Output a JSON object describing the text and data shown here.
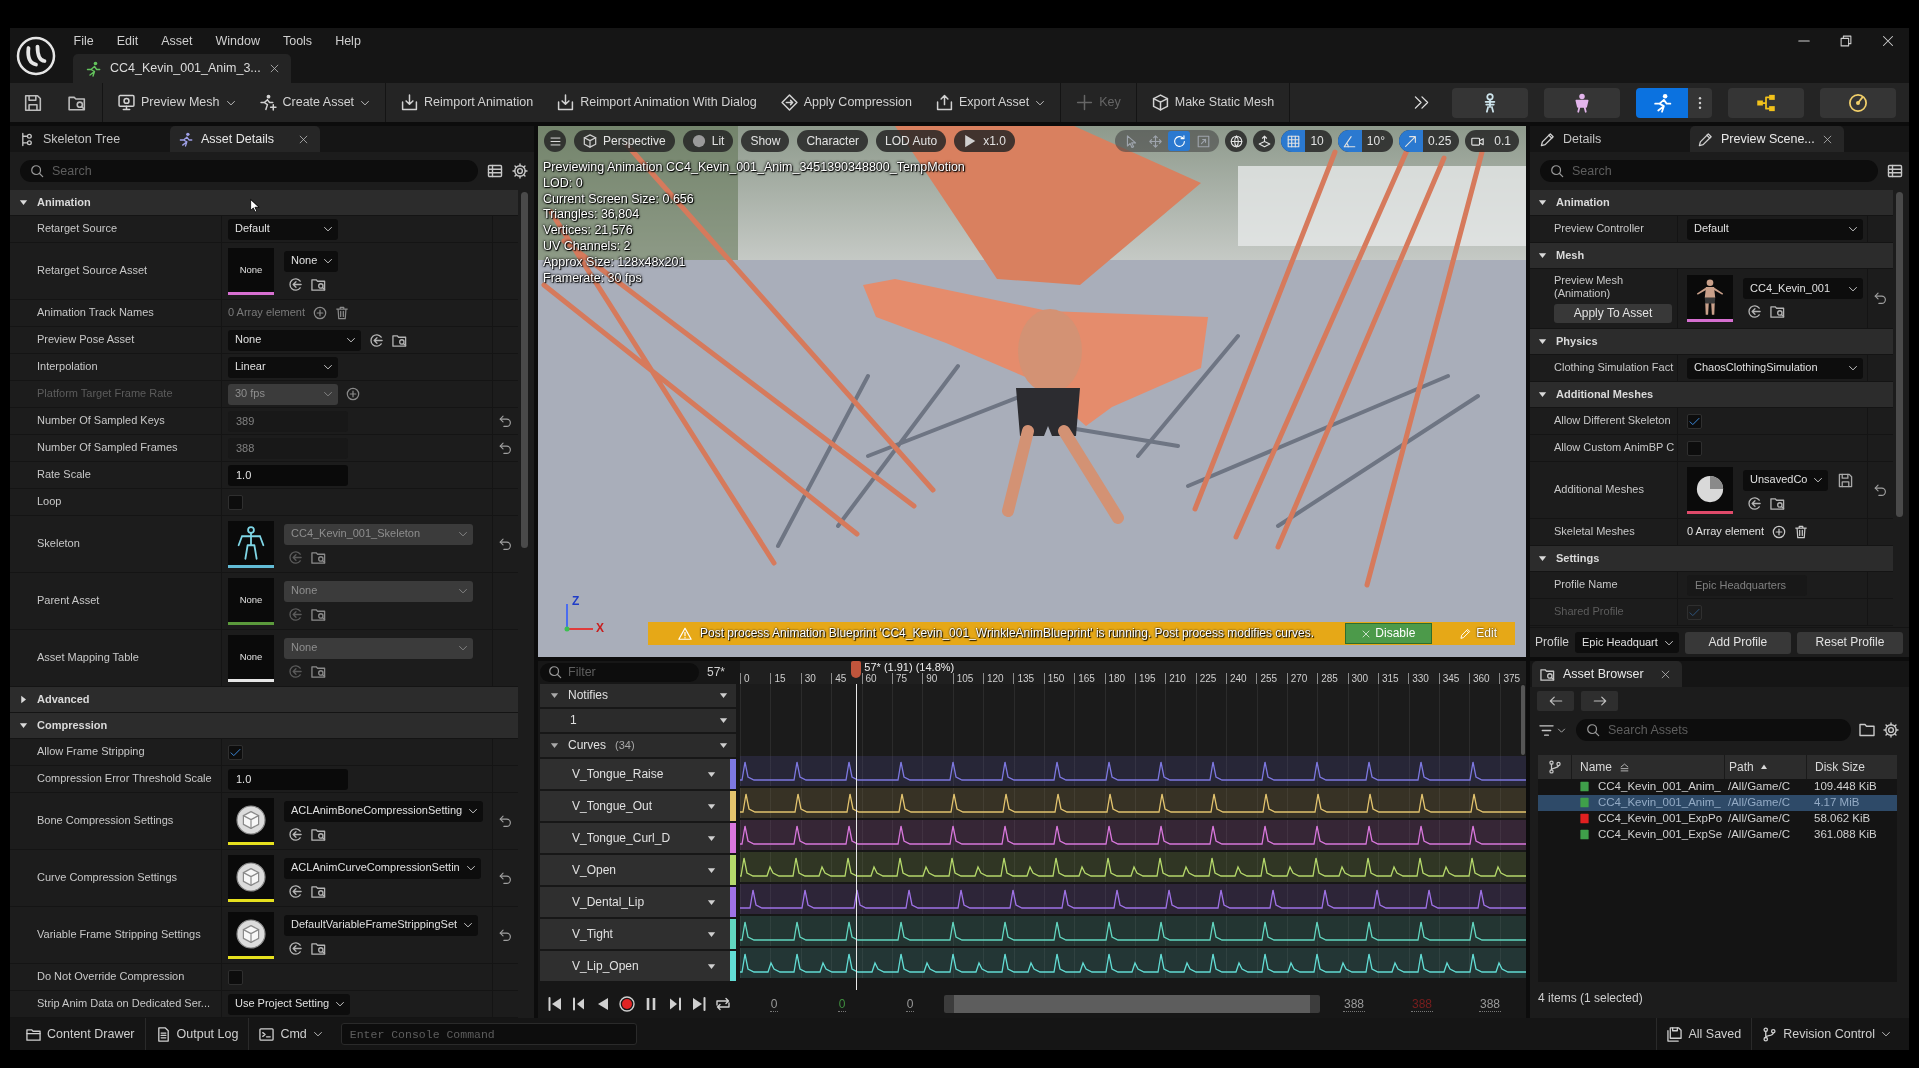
{
  "window": {
    "menu": [
      "File",
      "Edit",
      "Asset",
      "Window",
      "Tools",
      "Help"
    ],
    "document_tab": {
      "title": "CC4_Kevin_001_Anim_3...",
      "selected": true
    }
  },
  "toolbar": {
    "groups": [
      [
        {
          "label": "Preview Mesh",
          "dropdown": true,
          "disabled": false
        },
        {
          "label": "Create Asset",
          "dropdown": true,
          "disabled": false
        }
      ],
      [
        {
          "label": "Reimport Animation",
          "dropdown": false,
          "disabled": false
        },
        {
          "label": "Reimport Animation With Dialog",
          "dropdown": false,
          "disabled": false
        },
        {
          "label": "Apply Compression",
          "dropdown": false,
          "disabled": false
        },
        {
          "label": "Export Asset",
          "dropdown": true,
          "disabled": false
        }
      ],
      [
        {
          "label": "Key",
          "dropdown": false,
          "disabled": true
        }
      ],
      [
        {
          "label": "Make Static Mesh",
          "dropdown": false,
          "disabled": false
        }
      ]
    ],
    "modes": [
      {
        "selected": false
      },
      {
        "selected": false
      },
      {
        "selected": true
      },
      {
        "selected": false
      },
      {
        "selected": false
      }
    ]
  },
  "left_panel": {
    "tabs": [
      {
        "label": "Skeleton Tree",
        "selected": false
      },
      {
        "label": "Asset Details",
        "selected": true
      }
    ],
    "search": {
      "placeholder": "Search"
    },
    "sections": [
      {
        "title": "Animation",
        "expanded": true,
        "properties": [
          {
            "label": "Retarget Source",
            "kind": "dropdown",
            "value": "Default",
            "disabled": false,
            "read_only": false,
            "resettable": false
          },
          {
            "label": "Retarget Source Asset",
            "kind": "asset",
            "value": "None",
            "thumbnail": {
              "kind": "empty",
              "text": "None",
              "color": "#d66fd0"
            },
            "disabled": false,
            "read_only": false,
            "resettable": false
          },
          {
            "label": "Animation Track Names",
            "kind": "array",
            "value": "0 Array element",
            "disabled": false,
            "read_only": true,
            "resettable": false
          },
          {
            "label": "Preview Pose Asset",
            "kind": "asset_inline",
            "value": "None",
            "disabled": false,
            "read_only": false,
            "resettable": false
          },
          {
            "label": "Interpolation",
            "kind": "dropdown",
            "value": "Linear",
            "disabled": false,
            "read_only": false,
            "resettable": false
          },
          {
            "label": "Platform Target Frame Rate",
            "kind": "dropdown_add",
            "value": "30 fps",
            "disabled": true,
            "read_only": true,
            "resettable": false
          },
          {
            "label": "Number Of Sampled Keys",
            "kind": "number",
            "value": "389",
            "disabled": false,
            "read_only": true,
            "resettable": true
          },
          {
            "label": "Number Of Sampled Frames",
            "kind": "number",
            "value": "388",
            "disabled": false,
            "read_only": true,
            "resettable": true
          },
          {
            "label": "Rate Scale",
            "kind": "number",
            "value": "1.0",
            "disabled": false,
            "read_only": false,
            "resettable": false
          },
          {
            "label": "Loop",
            "kind": "checkbox",
            "checked": false,
            "disabled": false,
            "resettable": false
          },
          {
            "label": "Skeleton",
            "kind": "asset",
            "value": "CC4_Kevin_001_Skeleton",
            "thumbnail": {
              "kind": "skeleton",
              "color": "#62bcd6"
            },
            "disabled": false,
            "read_only": true,
            "resettable": true
          },
          {
            "label": "Parent Asset",
            "kind": "asset",
            "value": "None",
            "thumbnail": {
              "kind": "empty",
              "text": "None",
              "color": "#5b9a3c"
            },
            "disabled": false,
            "read_only": true,
            "resettable": false
          },
          {
            "label": "Asset Mapping Table",
            "kind": "asset",
            "value": "None",
            "thumbnail": {
              "kind": "empty",
              "text": "None",
              "color": "#e6e6e6"
            },
            "disabled": false,
            "read_only": true,
            "resettable": false
          }
        ]
      },
      {
        "title": "Advanced",
        "expanded": false
      },
      {
        "title": "Compression",
        "expanded": true,
        "properties": [
          {
            "label": "Allow Frame Stripping",
            "kind": "checkbox",
            "checked": true,
            "disabled": false,
            "resettable": false
          },
          {
            "label": "Compression Error Threshold Scale",
            "kind": "number",
            "value": "1.0",
            "disabled": false,
            "read_only": false,
            "resettable": false
          },
          {
            "label": "Bone Compression Settings",
            "kind": "asset",
            "value": "ACLAnimBoneCompressionSetting",
            "thumbnail": {
              "kind": "sphere",
              "color": "#e6e01e"
            },
            "disabled": false,
            "read_only": false,
            "resettable": true
          },
          {
            "label": "Curve Compression Settings",
            "kind": "asset",
            "value": "ACLAnimCurveCompressionSettin",
            "thumbnail": {
              "kind": "sphere",
              "color": "#e6e01e"
            },
            "disabled": false,
            "read_only": false,
            "resettable": true
          },
          {
            "label": "Variable Frame Stripping Settings",
            "kind": "asset",
            "value": "DefaultVariableFrameStrippingSet",
            "thumbnail": {
              "kind": "sphere",
              "color": "#e6e01e"
            },
            "disabled": false,
            "read_only": false,
            "resettable": true
          },
          {
            "label": "Do Not Override Compression",
            "kind": "checkbox",
            "checked": false,
            "disabled": false,
            "resettable": false
          },
          {
            "label": "Strip Anim Data on Dedicated Ser...",
            "kind": "dropdown",
            "value": "Use Project Setting",
            "disabled": false,
            "read_only": false,
            "resettable": false
          }
        ]
      }
    ]
  },
  "viewport": {
    "view_options": [
      "Perspective",
      "Lit",
      "Show",
      "Character",
      "LOD Auto",
      "x1.0"
    ],
    "transform_tools": [
      {
        "selected": false
      },
      {
        "selected": false
      },
      {
        "selected": true
      },
      {
        "selected": false
      }
    ],
    "snaps": [
      {
        "value": "10",
        "on": true
      },
      {
        "value": "10°",
        "on": true
      },
      {
        "value": "0.25",
        "on": true
      },
      {
        "value": "0.1",
        "on": false
      }
    ],
    "stats": [
      "Previewing Animation CC4_Kevin_001_Anim_3451390348800_TempMotion",
      "LOD: 0",
      "Current Screen Size: 0.656",
      "Triangles: 36,804",
      "Vertices: 21,576",
      "UV Channels: 2",
      "Approx Size: 128x48x201",
      "Framerate: 30 fps"
    ],
    "axes": [
      "Z",
      "X"
    ],
    "notice": {
      "text": "Post process Animation Blueprint 'CC4_Kevin_001_WrinkleAnimBlueprint' is running. Post process modifies curves.",
      "actions": [
        {
          "label": "Disable",
          "kind": "button"
        },
        {
          "label": "Edit",
          "kind": "link"
        }
      ]
    }
  },
  "timeline": {
    "filter": {
      "placeholder": "Filter"
    },
    "frame": "57*",
    "ruler": [
      "0",
      "15",
      "30",
      "45",
      "60",
      "75",
      "90",
      "105",
      "120",
      "135",
      "150",
      "165",
      "180",
      "195",
      "210",
      "225",
      "240",
      "255",
      "270",
      "285",
      "300",
      "315",
      "330",
      "345",
      "360",
      "375"
    ],
    "playhead": {
      "label": "57* (1.91) (14.8%)",
      "level": 0.148
    },
    "notifies": {
      "label": "Notifies",
      "expanded": true,
      "tracks": [
        "1"
      ]
    },
    "curves": {
      "label": "Curves",
      "count": "(34)",
      "expanded": true,
      "items": [
        {
          "name": "V_Tongue_Raise",
          "color": "#7d78e0"
        },
        {
          "name": "V_Tongue_Out",
          "color": "#e2c36e"
        },
        {
          "name": "V_Tongue_Curl_D",
          "color": "#d877dc"
        },
        {
          "name": "V_Open",
          "color": "#b5d86b"
        },
        {
          "name": "V_Dental_Lip",
          "color": "#9f72e6"
        },
        {
          "name": "V_Tight",
          "color": "#62d6c0"
        },
        {
          "name": "V_Lip_Open",
          "color": "#62dcd4"
        }
      ]
    },
    "range_start": [
      {
        "text": "0",
        "color": "#9a9a9a"
      },
      {
        "text": "0",
        "color": "#3f8f3f"
      },
      {
        "text": "0",
        "color": "#9a9a9a"
      }
    ],
    "range_end": [
      {
        "text": "388",
        "color": "#9a9a9a"
      },
      {
        "text": "388",
        "color": "#7a1e1e"
      },
      {
        "text": "388",
        "color": "#9a9a9a"
      }
    ]
  },
  "right_panel": {
    "tabs": [
      {
        "label": "Details",
        "selected": false
      },
      {
        "label": "Preview Scene...",
        "selected": true
      }
    ],
    "search": {
      "placeholder": "Search"
    },
    "sections": [
      {
        "title": "Animation",
        "expanded": true,
        "properties": [
          {
            "label": "Preview Controller",
            "kind": "dropdown",
            "value": "Default",
            "disabled": false,
            "read_only": false,
            "resettable": false
          }
        ]
      },
      {
        "title": "Mesh",
        "expanded": true,
        "properties": [
          {
            "label": "Preview Mesh (Animation)",
            "kind": "asset",
            "value": "CC4_Kevin_001",
            "button": "Apply To Asset",
            "thumbnail": {
              "kind": "figure",
              "color": "#d66fd0"
            },
            "disabled": false,
            "read_only": false,
            "resettable": true
          }
        ]
      },
      {
        "title": "Physics",
        "expanded": true,
        "properties": [
          {
            "label": "Clothing Simulation Fact",
            "kind": "dropdown",
            "value": "ChaosClothingSimulation",
            "disabled": false,
            "read_only": false,
            "resettable": false
          }
        ]
      },
      {
        "title": "Additional Meshes",
        "expanded": true,
        "properties": [
          {
            "label": "Allow Different Skeleton",
            "kind": "checkbox",
            "checked": true,
            "disabled": false,
            "resettable": false
          },
          {
            "label": "Allow Custom AnimBP C",
            "kind": "checkbox",
            "checked": false,
            "disabled": false,
            "resettable": false
          },
          {
            "label": "Additional Meshes",
            "kind": "asset_save",
            "value": "UnsavedCo",
            "thumbnail": {
              "kind": "pie",
              "color": "#e04a6a"
            },
            "disabled": false,
            "read_only": false,
            "resettable": true
          },
          {
            "label": "Skeletal Meshes",
            "kind": "array",
            "value": "0 Array element",
            "disabled": false,
            "read_only": false,
            "resettable": false
          }
        ]
      },
      {
        "title": "Settings",
        "expanded": true,
        "properties": [
          {
            "label": "Profile Name",
            "kind": "text",
            "value": "Epic Headquarters",
            "disabled": false,
            "read_only": true,
            "resettable": false
          },
          {
            "label": "Shared Profile",
            "kind": "checkbox",
            "checked": true,
            "disabled": true,
            "resettable": false
          }
        ]
      }
    ],
    "profile": {
      "label": "Profile",
      "value": "Epic Headquart",
      "buttons": [
        "Add Profile",
        "Reset Profile"
      ]
    }
  },
  "asset_browser": {
    "tab": {
      "label": "Asset Browser",
      "selected": true
    },
    "search": {
      "placeholder": "Search Assets"
    },
    "columns": [
      {
        "label": "Name",
        "kind": "secondary"
      },
      {
        "label": "Path",
        "kind": "ascending"
      },
      {
        "label": "Disk Size",
        "kind": "plain"
      }
    ],
    "rows": [
      {
        "name": "CC4_Kevin_001_Anim_",
        "path": "/All/Game/C",
        "size": "109.448 KiB",
        "color": "#3f9f4a",
        "selected": false
      },
      {
        "name": "CC4_Kevin_001_Anim_",
        "path": "/All/Game/C",
        "size": "4.17 MiB",
        "color": "#3f9f4a",
        "selected": true
      },
      {
        "name": "CC4_Kevin_001_ExpPo",
        "path": "/All/Game/C",
        "size": "58.062 KiB",
        "color": "#e02020",
        "selected": false
      },
      {
        "name": "CC4_Kevin_001_ExpSe",
        "path": "/All/Game/C",
        "size": "361.088 KiB",
        "color": "#3f9f4a",
        "selected": false
      }
    ],
    "status": "4 items (1 selected)"
  },
  "status_bar": {
    "left": [
      {
        "label": "Content Drawer",
        "dropdown": false
      },
      {
        "label": "Output Log",
        "dropdown": false
      },
      {
        "label": "Cmd",
        "dropdown": true
      }
    ],
    "console": {
      "placeholder": "Enter Console Command"
    },
    "right": [
      {
        "label": "All Saved",
        "dropdown": false
      },
      {
        "label": "Revision Control",
        "dropdown": true
      }
    ]
  }
}
